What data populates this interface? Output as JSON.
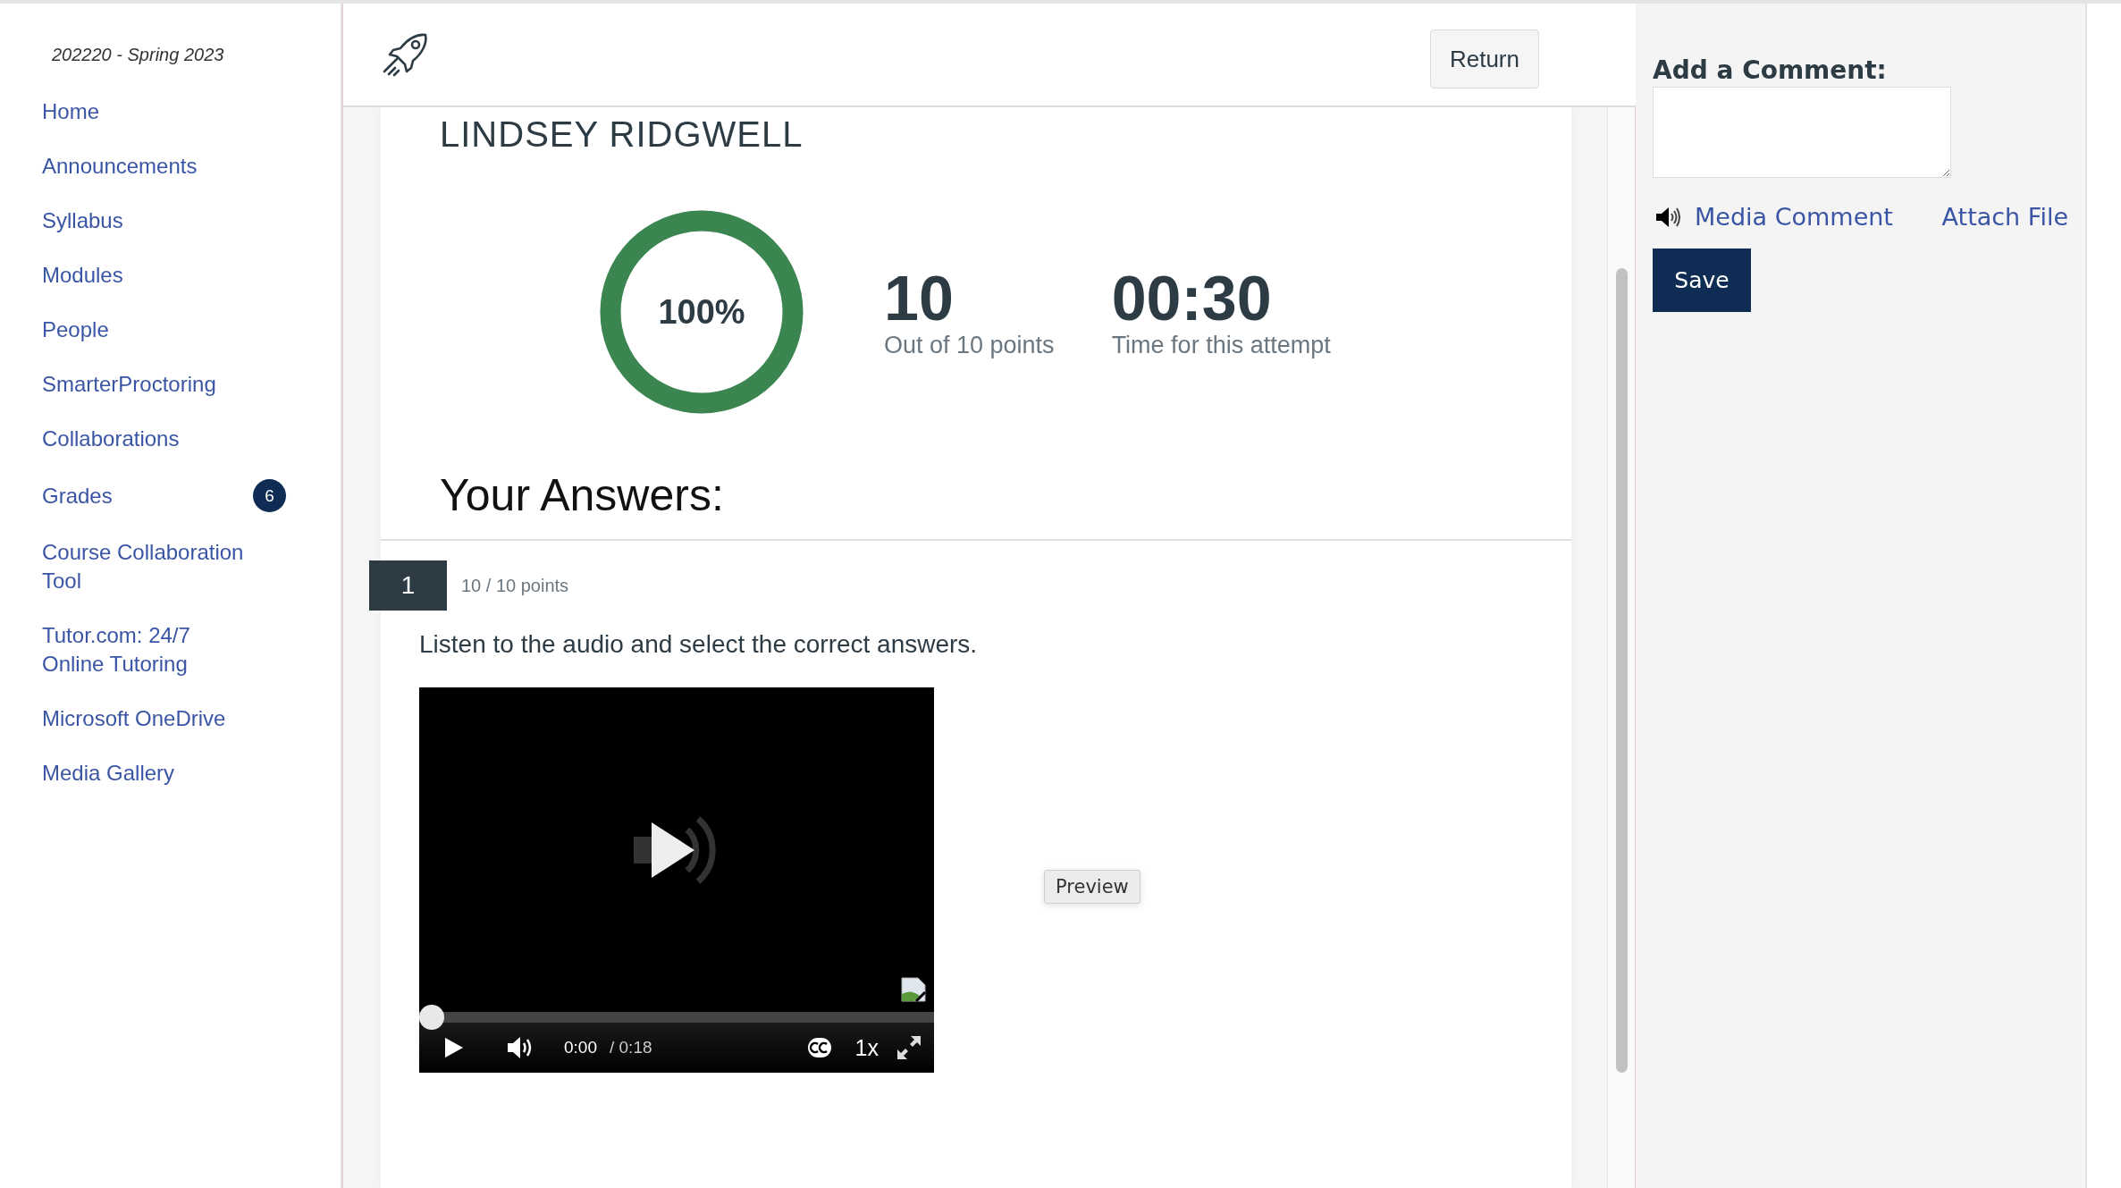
{
  "sidebar": {
    "term": "202220 - Spring 2023",
    "items": [
      {
        "label": "Home"
      },
      {
        "label": "Announcements"
      },
      {
        "label": "Syllabus"
      },
      {
        "label": "Modules"
      },
      {
        "label": "People"
      },
      {
        "label": "SmarterProctoring"
      },
      {
        "label": "Collaborations"
      },
      {
        "label": "Grades",
        "badge": "6"
      },
      {
        "label": "Course Collaboration Tool"
      },
      {
        "label": "Tutor.com: 24/7 Online Tutoring"
      },
      {
        "label": "Microsoft OneDrive"
      },
      {
        "label": "Media Gallery"
      }
    ]
  },
  "header": {
    "return_button": "Return"
  },
  "result": {
    "student_name": "LINDSEY RIDGWELL",
    "score_percent": "100%",
    "level": 1,
    "points": "10",
    "points_caption": "Out of 10 points",
    "time": "00:30",
    "time_caption": "Time for this attempt"
  },
  "answers_heading": "Your Answers:",
  "question": {
    "number": "1",
    "points": "10 / 10 points",
    "text": "Listen to the audio and select the correct answers.",
    "player": {
      "level": 0,
      "current_time": "0:00",
      "duration": "/ 0:18",
      "speed": "1x"
    },
    "preview_button": "Preview"
  },
  "comment_panel": {
    "label": "Add a Comment:",
    "media_comment": "Media Comment",
    "attach_file": "Attach File",
    "save_button": "Save"
  }
}
